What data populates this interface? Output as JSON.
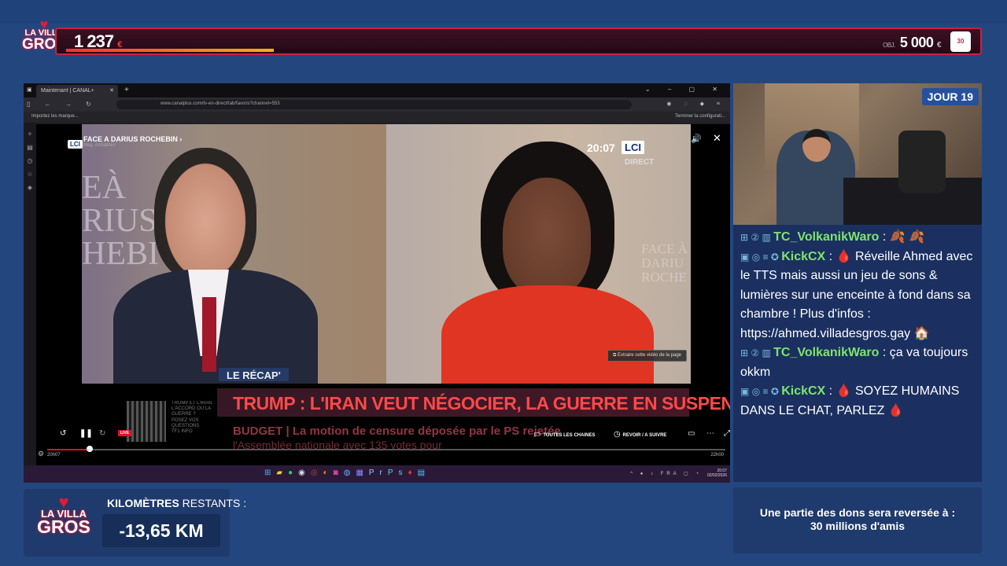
{
  "top_bar": {
    "logo": {
      "line1": "LA VILLA",
      "line2": "GROS"
    },
    "current_amount": "1 237",
    "currency": "€",
    "progress_fraction": 0.24,
    "objective_label": "OBJ.",
    "objective_amount": "5 000",
    "objective_currency": "€",
    "charity_badge": "30"
  },
  "browser": {
    "tab_title": "Maintenant | CANAL+",
    "url": "www.canalplus.com/tv-en-direct/tab/favoris?channel=553",
    "bookmark_left": "Importez les marque...",
    "bookmark_right": "Terminer la configurati..."
  },
  "video": {
    "program_title": "FACE A DARIUS ROCHEBIN",
    "program_subtitle": "Mag. Actualités",
    "channel_small": "LCI",
    "clock": "20:07",
    "channel_logo": "LCI",
    "direct": "DIRECT",
    "bg_text_left": "EÀ\nRIUS\nHEBI",
    "bg_text_right": "FACE À\nDARIU\nROCHE",
    "extract_button": "Extraire cette vidéo de la page",
    "recap_tag": "LE RÉCAP'",
    "headline": "TRUMP : L'IRAN VEUT NÉGOCIER, LA GUERRE EN SUSPENS",
    "budget_line1": "BUDGET | La motion de censure déposée par le PS rejetée",
    "budget_line2": "l'Assemblée nationale avec 135 votes pour",
    "qr_text": "TRUMP ET L'IRAN.\nL'ACCORD OU LA\nGUERRE ?\nPOSEZ VOS\nQUESTIONS\nTF1 INFO",
    "live_badge": "LIVE",
    "all_channels": "TOUTES LES CHAINES",
    "replay": "REVOIR / A SUIVRE",
    "progress_fraction": 0.06,
    "time_start": "20h07",
    "time_end": "22h00"
  },
  "taskbar": {
    "tray": "FRA",
    "time": "20:07",
    "date": "02/02/2026"
  },
  "cam": {
    "day_badge": "JOUR 19"
  },
  "chat": [
    {
      "badges": "⊞ ② ▥",
      "user": "TC_VolkanikWaro",
      "sep": " : ",
      "text": "🍂 🍂"
    },
    {
      "badges": "▣ ◎ ≡ ✪",
      "user": "KickCX",
      "sep": " : ",
      "text": "🩸 Réveille Ahmed avec le TTS mais aussi un jeu de sons & lumières sur une enceinte à fond dans sa chambre ! Plus d'infos : https://ahmed.villadesgros.gay 🏠"
    },
    {
      "badges": "⊞ ② ▥",
      "user": "TC_VolkanikWaro",
      "sep": " : ",
      "text": "ça va toujours okkm"
    },
    {
      "badges": "▣ ◎ ≡ ✪",
      "user": "KickCX",
      "sep": " : ",
      "text": "🩸 SOYEZ HUMAINS DANS LE CHAT, PARLEZ 🩸"
    }
  ],
  "km": {
    "label_bold": "KILOMÈTRES",
    "label_rest": " RESTANTS :",
    "value": "-13,65 KM",
    "logo_line1": "LA VILLA",
    "logo_line2": "GROS"
  },
  "donation": {
    "line1": "Une partie des dons sera reversée à :",
    "line2": "30 millions d'amis"
  },
  "colors": {
    "accent": "#d11f3d",
    "background": "#24467f",
    "chat_name": "#7ee56a",
    "headline": "#ff4949"
  }
}
